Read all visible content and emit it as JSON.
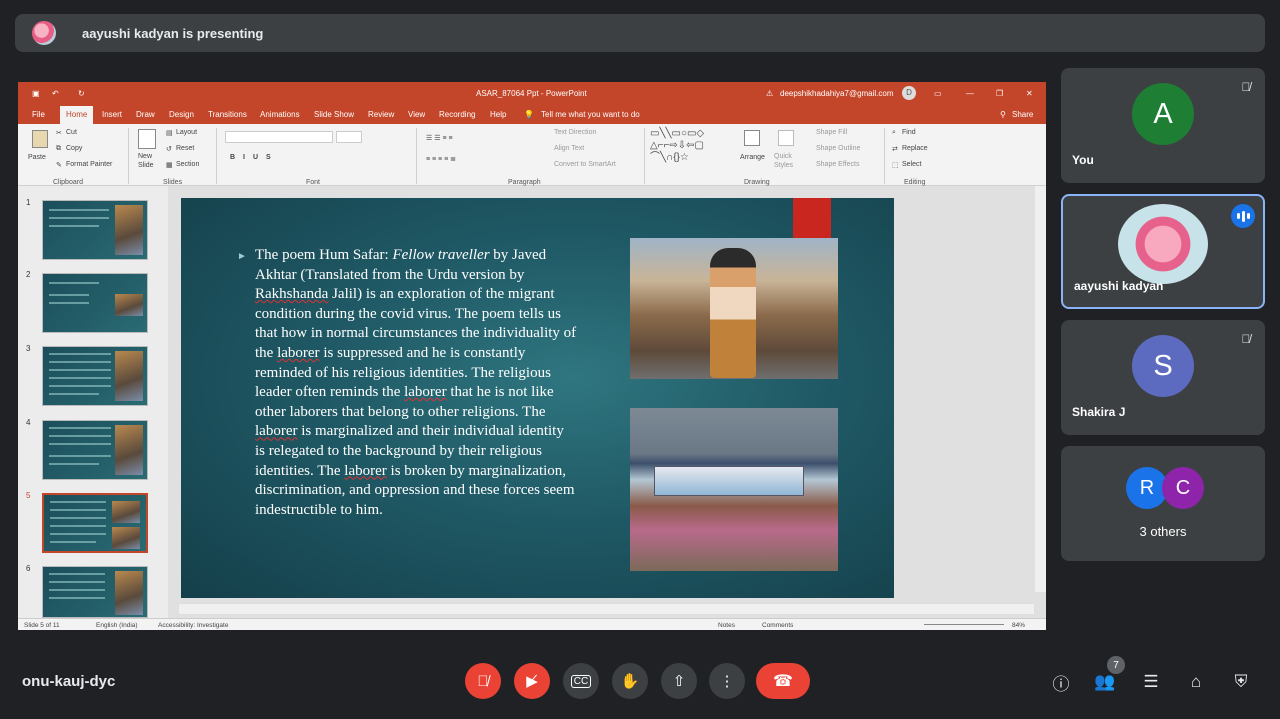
{
  "banner": {
    "text": "aayushi kadyan is presenting"
  },
  "powerpoint": {
    "title": "ASAR_87064 Ppt  -  PowerPoint",
    "account": "deepshikhadahiya7@gmail.com",
    "account_initial": "D",
    "tabs": [
      "File",
      "Home",
      "Insert",
      "Draw",
      "Design",
      "Transitions",
      "Animations",
      "Slide Show",
      "Review",
      "View",
      "Recording",
      "Help"
    ],
    "active_tab": "Home",
    "tell_me": "Tell me what you want to do",
    "share": "Share",
    "ribbon": {
      "cut": "Cut",
      "copy": "Copy",
      "format_painter": "Format Painter",
      "paste": "Paste",
      "new_slide": "New Slide",
      "layout": "Layout",
      "reset": "Reset",
      "section": "Section",
      "text_direction": "Text Direction",
      "align_text": "Align Text",
      "convert_smartart": "Convert to SmartArt",
      "arrange": "Arrange",
      "quick_styles": "Quick Styles",
      "shape_fill": "Shape Fill",
      "shape_outline": "Shape Outline",
      "shape_effects": "Shape Effects",
      "find": "Find",
      "replace": "Replace",
      "select": "Select",
      "groups": [
        "Clipboard",
        "Slides",
        "Font",
        "Paragraph",
        "Drawing",
        "Editing"
      ]
    },
    "thumbnails": [
      "1",
      "2",
      "3",
      "4",
      "5",
      "6"
    ],
    "selected_thumbnail": "5",
    "slide": {
      "text_pre_italic": "The poem Hum Safar: ",
      "text_italic": "Fellow traveller",
      "text_after_italic": " by Javed Akhtar (Translated from the Urdu version by ",
      "text_u1": "Rakhshanda",
      "text_mid1": " Jalil) is an exploration of the migrant condition during the covid virus. The poem tells us that how in normal circumstances the individuality of the ",
      "text_u2": "laborer",
      "text_mid2": " is suppressed and he is constantly reminded of his religious identities. The religious leader often reminds the ",
      "text_u3": "laborer",
      "text_mid3": " that he is not like other laborers that belong to other religions. The ",
      "text_u4": "laborer",
      "text_mid4": " is marginalized and their individual identity is relegated to the background by their religious identities. The ",
      "text_u5": "laborer",
      "text_end": " is broken by marginalization, discrimination, and oppression and these forces seem indestructible to him."
    },
    "status": {
      "slide_of": "Slide 5 of 11",
      "language": "English (India)",
      "accessibility": "Accessibility: Investigate",
      "notes": "Notes",
      "comments": "Comments",
      "zoom": "84%"
    }
  },
  "participants": [
    {
      "name": "You",
      "initial": "A",
      "color": "#1e7e34",
      "muted": true
    },
    {
      "name": "aayushi kadyan",
      "speaking": true
    },
    {
      "name": "Shakira J",
      "initial": "S",
      "color": "#5c6bc0",
      "muted": true
    },
    {
      "name": "3 others",
      "initials": [
        "R",
        "C"
      ],
      "colors": [
        "#1a73e8",
        "#8e24aa"
      ]
    }
  ],
  "meeting": {
    "code": "onu-kauj-dyc",
    "participant_count": "7"
  },
  "colors": {
    "powerpoint_accent": "#c4462a",
    "meet_bg": "#202124",
    "tile_bg": "#3c4043",
    "danger": "#ea4335",
    "speaking": "#1a73e8"
  }
}
